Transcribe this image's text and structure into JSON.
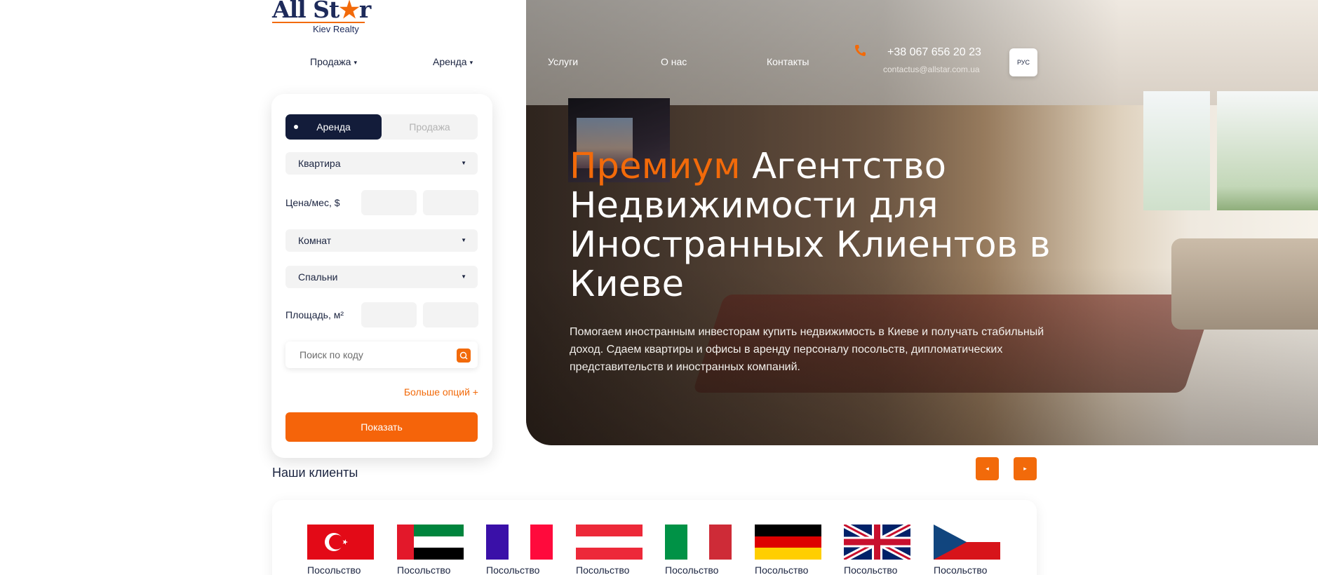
{
  "header": {
    "logo_main": "All St",
    "logo_star": "★",
    "logo_tail": "r",
    "logo_sub": "Kiev Realty",
    "nav": [
      {
        "label": "Продажа",
        "caret": "▾"
      },
      {
        "label": "Аренда",
        "caret": "▾"
      },
      {
        "label": "Услуги"
      },
      {
        "label": "О нас"
      },
      {
        "label": "Контакты"
      }
    ],
    "phone": "+38 067 656 20 23",
    "email": "contactus@allstar.com.ua",
    "language": "РУС"
  },
  "search_form": {
    "tab_active": "Аренда",
    "tab_inactive": "Продажа",
    "property_type": "Квартира",
    "price_label": "Цена/мес, $",
    "rooms": "Комнат",
    "bedrooms": "Спальни",
    "area_label": "Площадь, м²",
    "code_placeholder": "Поиск по коду",
    "more_options": "Больше опций +",
    "submit": "Показать"
  },
  "hero": {
    "title_accent": "Премиум",
    "title_rest": " Агентство Недвижимости для Иностранных Клиентов в Киеве",
    "lead": "Помогаем иностранным инвесторам купить недвижимость в Киеве и получать стабильный доход. Сдаем квартиры и офисы в аренду персоналу посольств, дипломатических представительств и иностранных компаний."
  },
  "clients": {
    "title": "Наши клиенты",
    "prev_arrow": "◂",
    "next_arrow": "▸",
    "items": [
      {
        "label": "Посольство",
        "flag": "turkey"
      },
      {
        "label": "Посольство",
        "flag": "uae"
      },
      {
        "label": "Посольство",
        "flag": "france"
      },
      {
        "label": "Посольство",
        "flag": "austria"
      },
      {
        "label": "Посольство",
        "flag": "italy"
      },
      {
        "label": "Посольство",
        "flag": "germany"
      },
      {
        "label": "Посольство",
        "flag": "united-kingdom"
      },
      {
        "label": "Посольство",
        "flag": "czech-republic"
      }
    ]
  },
  "colors": {
    "accent": "#f26a0a",
    "navy": "#131c3a"
  }
}
